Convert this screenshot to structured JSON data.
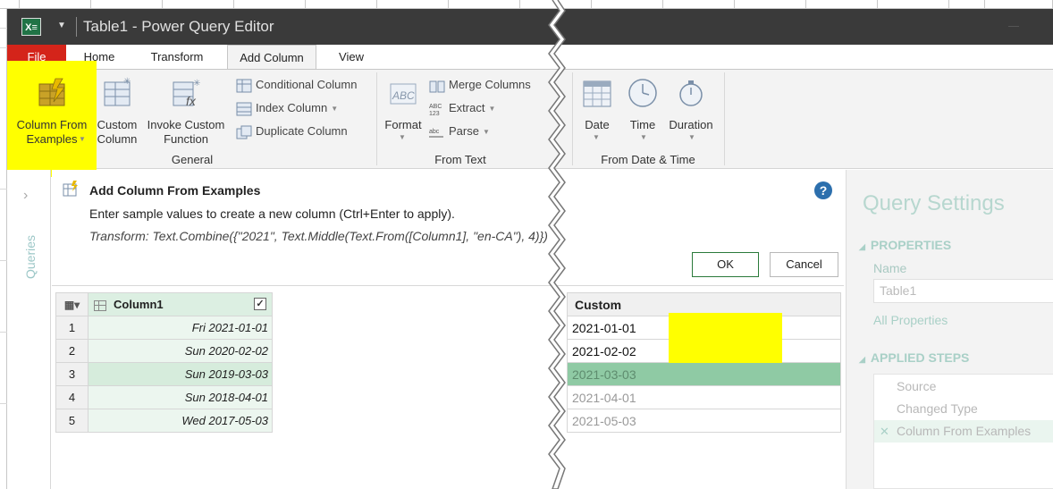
{
  "window": {
    "title": "Table1 - Power Query Editor",
    "app_icon": "excel-icon"
  },
  "tabs": [
    {
      "label": "File"
    },
    {
      "label": "Home"
    },
    {
      "label": "Transform"
    },
    {
      "label": "Add Column",
      "active": true
    },
    {
      "label": "View"
    }
  ],
  "ribbon": {
    "general": {
      "label": "General",
      "column_from_examples": "Column From Examples",
      "custom_column": "Custom Column",
      "invoke_custom_function": "Invoke Custom Function",
      "conditional_column": "Conditional Column",
      "index_column": "Index Column",
      "duplicate_column": "Duplicate Column"
    },
    "from_text": {
      "label": "From Text",
      "format": "Format",
      "merge_columns": "Merge Columns",
      "extract": "Extract",
      "parse": "Parse"
    },
    "from_date_time": {
      "label": "From Date & Time",
      "date": "Date",
      "time": "Time",
      "duration": "Duration"
    }
  },
  "queries_pane": {
    "label": "Queries"
  },
  "add_column_from_examples": {
    "title": "Add Column From Examples",
    "subtitle": "Enter sample values to create a new column (Ctrl+Enter to apply).",
    "formula": "Transform: Text.Combine({\"2021\", Text.Middle(Text.From([Column1], \"en-CA\"), 4)})",
    "ok_label": "OK",
    "cancel_label": "Cancel"
  },
  "source_table": {
    "column_header": "Column1",
    "rows": [
      {
        "num": "1",
        "value": "Fri 2021-01-01"
      },
      {
        "num": "2",
        "value": "Sun 2020-02-02"
      },
      {
        "num": "3",
        "value": "Sun 2019-03-03"
      },
      {
        "num": "4",
        "value": "Sun 2018-04-01"
      },
      {
        "num": "5",
        "value": "Wed 2017-05-03"
      }
    ]
  },
  "custom_table": {
    "column_header": "Custom",
    "rows": [
      {
        "value": "2021-01-01",
        "state": "entered"
      },
      {
        "value": "2021-02-02",
        "state": "entered"
      },
      {
        "value": "2021-03-03",
        "state": "selected"
      },
      {
        "value": "2021-04-01",
        "state": "suggested"
      },
      {
        "value": "2021-05-03",
        "state": "suggested"
      }
    ]
  },
  "query_settings": {
    "title": "Query Settings",
    "properties_label": "PROPERTIES",
    "name_label": "Name",
    "name_value": "Table1",
    "all_properties_link": "All Properties",
    "applied_steps_label": "APPLIED STEPS",
    "steps": [
      {
        "label": "Source"
      },
      {
        "label": "Changed Type"
      },
      {
        "label": "Column From Examples",
        "active": true
      }
    ]
  },
  "colors": {
    "highlight": "#ffff00",
    "file_tab": "#d4241a",
    "titlebar": "#3a3a3a",
    "selected_row": "#8fcaa4",
    "accent_teal": "#a9d0c7"
  }
}
